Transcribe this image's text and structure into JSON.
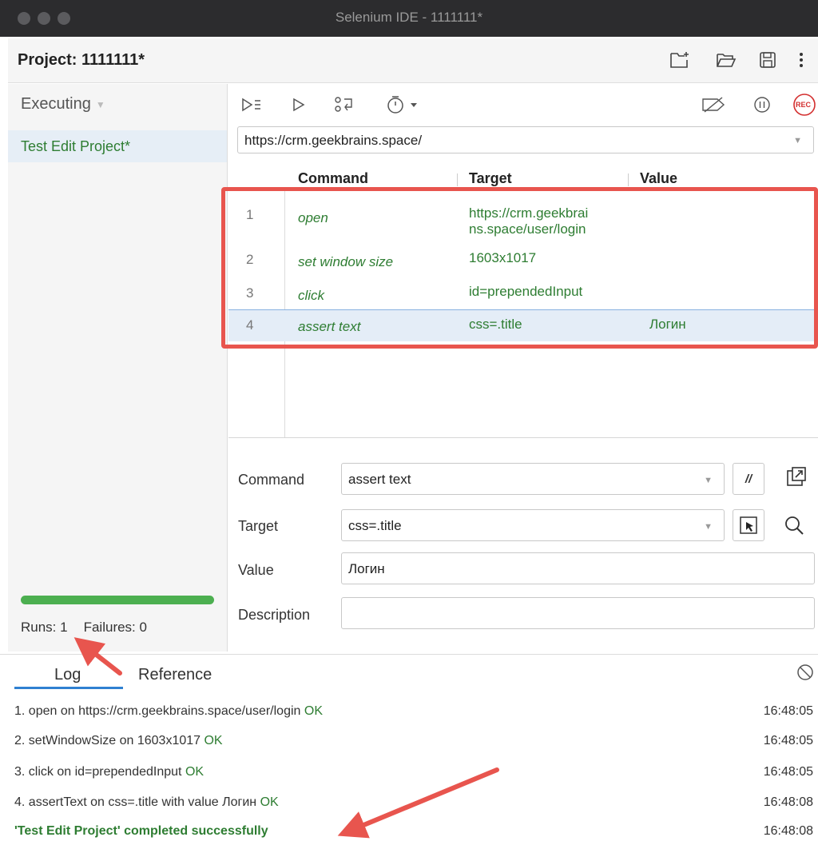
{
  "window": {
    "title": "Selenium IDE - 1111111*"
  },
  "project": {
    "label": "Project: 1111111*"
  },
  "sidebar": {
    "mode": "Executing",
    "suites": [
      {
        "name": "Test Edit Project*"
      }
    ],
    "runs_label": "Runs: 1",
    "failures_label": "Failures: 0",
    "progress_fraction": 1.0
  },
  "toolbar": {
    "rec_label": "REC"
  },
  "url": {
    "value": "https://crm.geekbrains.space/"
  },
  "table": {
    "headers": {
      "command": "Command",
      "target": "Target",
      "value": "Value"
    },
    "rows": [
      {
        "n": "1",
        "command": "open",
        "target_l1": "https://crm.geekbrai",
        "target_l2": "ns.space/user/login",
        "value": ""
      },
      {
        "n": "2",
        "command": "set window size",
        "target_l1": "1603x1017",
        "target_l2": "",
        "value": ""
      },
      {
        "n": "3",
        "command": "click",
        "target_l1": "id=prependedInput",
        "target_l2": "",
        "value": ""
      },
      {
        "n": "4",
        "command": "assert text",
        "target_l1": "css=.title",
        "target_l2": "",
        "value": "Логин"
      }
    ]
  },
  "editor": {
    "command_label": "Command",
    "command_value": "assert text",
    "comment_btn": "//",
    "target_label": "Target",
    "target_value": "css=.title",
    "value_label": "Value",
    "value_value": "Логин",
    "description_label": "Description",
    "description_value": ""
  },
  "log": {
    "tabs": {
      "log": "Log",
      "reference": "Reference"
    },
    "lines": [
      {
        "text": "1.  open on https://crm.geekbrains.space/user/login ",
        "ok": "OK",
        "time": "16:48:05"
      },
      {
        "text": "2.  setWindowSize on 1603x1017 ",
        "ok": "OK",
        "time": "16:48:05"
      },
      {
        "text": "3.  click on id=prependedInput ",
        "ok": "OK",
        "time": "16:48:05"
      },
      {
        "text": "4.  assertText on css=.title with value Логин ",
        "ok": "OK",
        "time": "16:48:08"
      }
    ],
    "final": {
      "text": "'Test Edit Project' completed successfully",
      "time": "16:48:08"
    }
  },
  "colors": {
    "accent_green": "#2e7d32",
    "annotation_red": "#e8554e",
    "tab_blue": "#2f80d1",
    "progress": "#4caf50"
  }
}
